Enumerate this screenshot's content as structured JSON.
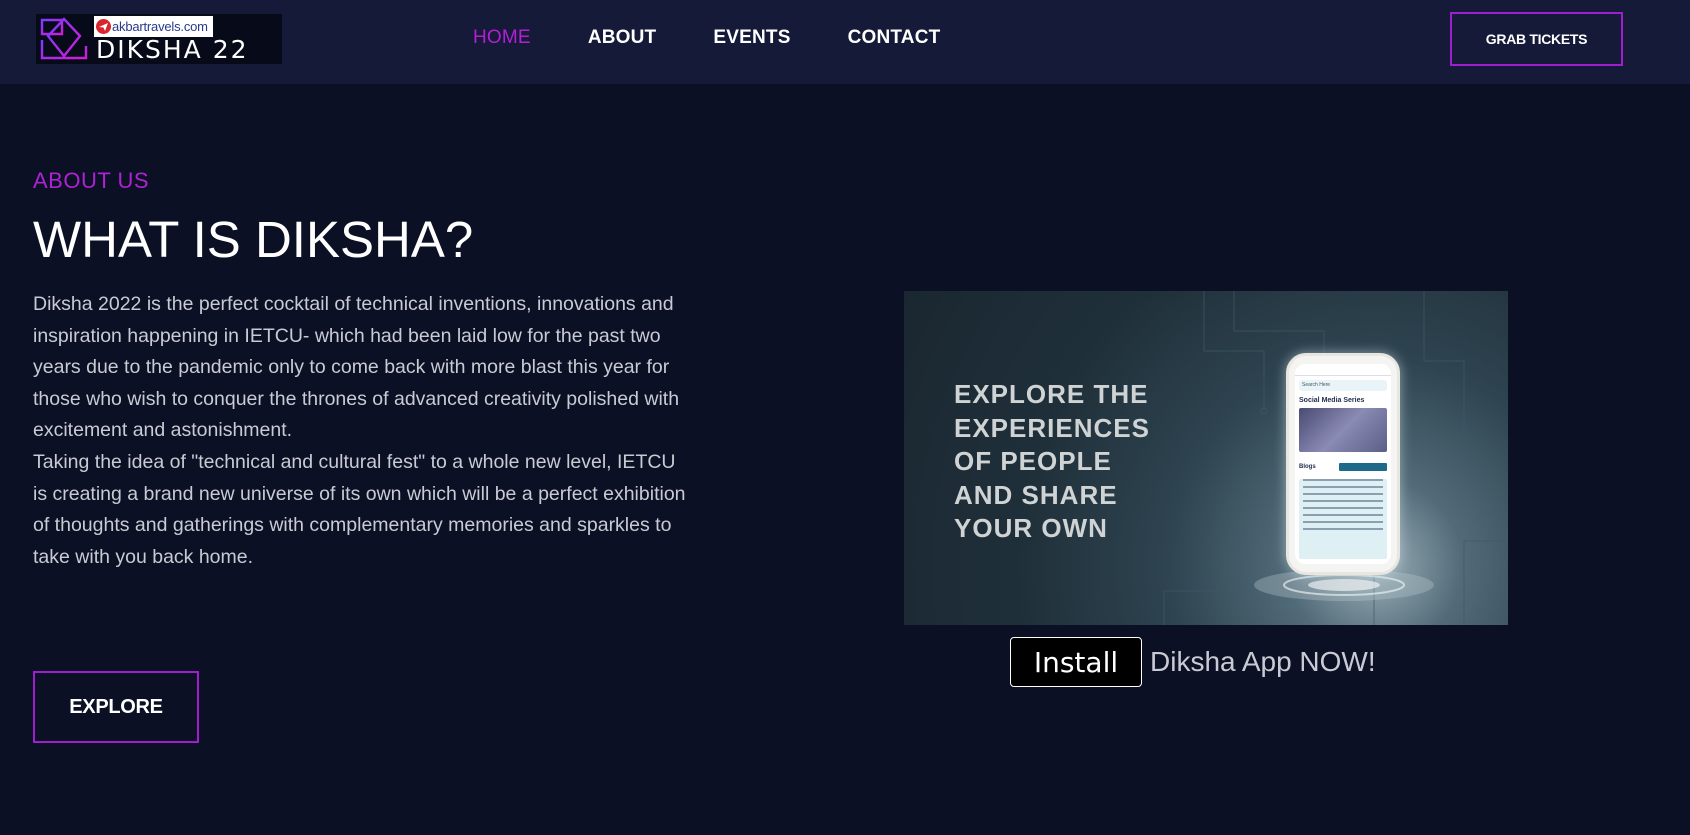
{
  "header": {
    "brand": "DIKSHA 22",
    "sponsor": "akbartravels.com",
    "nav": [
      "HOME",
      "ABOUT",
      "EVENTS",
      "CONTACT"
    ],
    "active_nav": "HOME",
    "cta_label": "GRAB TICKETS"
  },
  "about": {
    "label": "ABOUT US",
    "title": "WHAT IS DIKSHA?",
    "paragraph_1": "Diksha 2022 is the perfect cocktail of technical inventions, innovations and inspiration happening in IETCU- which had been laid low for the past two years due to the pandemic only to come back with more blast this year for those who wish to conquer the thrones of advanced creativity polished with excitement and astonishment.",
    "paragraph_2": "Taking the idea of \"technical and cultural fest\" to a whole new level, IETCU is creating a brand new universe of its own which will be a perfect exhibition of thoughts and gatherings with complementary memories and sparkles to take with you back home.",
    "explore_label": "EXPLORE"
  },
  "promo": {
    "lines": [
      "EXPLORE THE",
      "EXPERIENCES",
      "OF PEOPLE",
      "AND SHARE",
      "YOUR OWN"
    ],
    "phone": {
      "search_text": "Search Here",
      "section_title": "Social Media Series",
      "blogs_label": "Blogs"
    },
    "install_label": "Install",
    "install_tail": "Diksha App NOW!"
  },
  "colors": {
    "accent": "#ac22d4",
    "background": "#0b1024",
    "navbar": "#141a38",
    "body_text": "#c9cad3"
  },
  "icons": [
    "diksha-logo-icon",
    "akbar-travels-plane-icon"
  ]
}
